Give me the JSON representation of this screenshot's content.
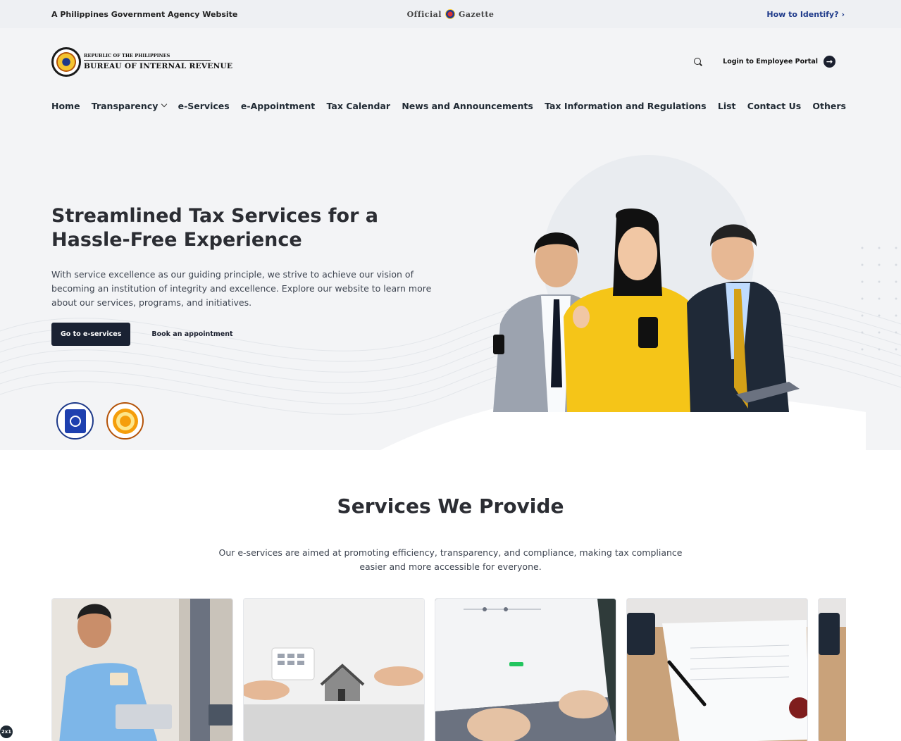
{
  "gov_bar": {
    "left_text": "A Philippines Government Agency Website",
    "center_text_1": "Official",
    "center_text_2": "Gazette",
    "right_text": "How to Identify?",
    "right_icon": "chevron-right-icon"
  },
  "brand": {
    "line1": "REPUBLIC OF THE PHILIPPINES",
    "line2": "BUREAU OF INTERNAL REVENUE"
  },
  "header": {
    "search_icon": "search-icon",
    "portal_label": "Login to Employee Portal",
    "portal_icon": "arrow-right-icon"
  },
  "nav": {
    "items": [
      {
        "label": "Home"
      },
      {
        "label": "Transparency",
        "dropdown": true
      },
      {
        "label": "e-Services"
      },
      {
        "label": "e-Appointment"
      },
      {
        "label": "Tax Calendar"
      },
      {
        "label": "News and Announcements"
      },
      {
        "label": "Tax Information and Regulations"
      },
      {
        "label": "List"
      },
      {
        "label": "Contact Us"
      },
      {
        "label": "Others"
      }
    ]
  },
  "hero": {
    "title": "Streamlined Tax Services for a Hassle-Free Experience",
    "description": "With service excellence as our guiding principle, we strive to achieve our vision of becoming an institution of integrity and excellence. Explore our website to learn more about our services, programs, and initiatives.",
    "primary_button": "Go to e-services",
    "secondary_button": "Book an appointment",
    "slides_total": 2,
    "active_slide": 1
  },
  "services": {
    "title": "Services We Provide",
    "description": "Our e-services are aimed at promoting efficiency, transparency, and compliance, making tax compliance easier and more accessible for everyone."
  },
  "footer_tag": "2x1",
  "colors": {
    "primary_dark": "#1a2233",
    "accent_blue": "#1e3a8a",
    "hero_bg": "#f3f4f6",
    "yellow": "#f4c430"
  }
}
